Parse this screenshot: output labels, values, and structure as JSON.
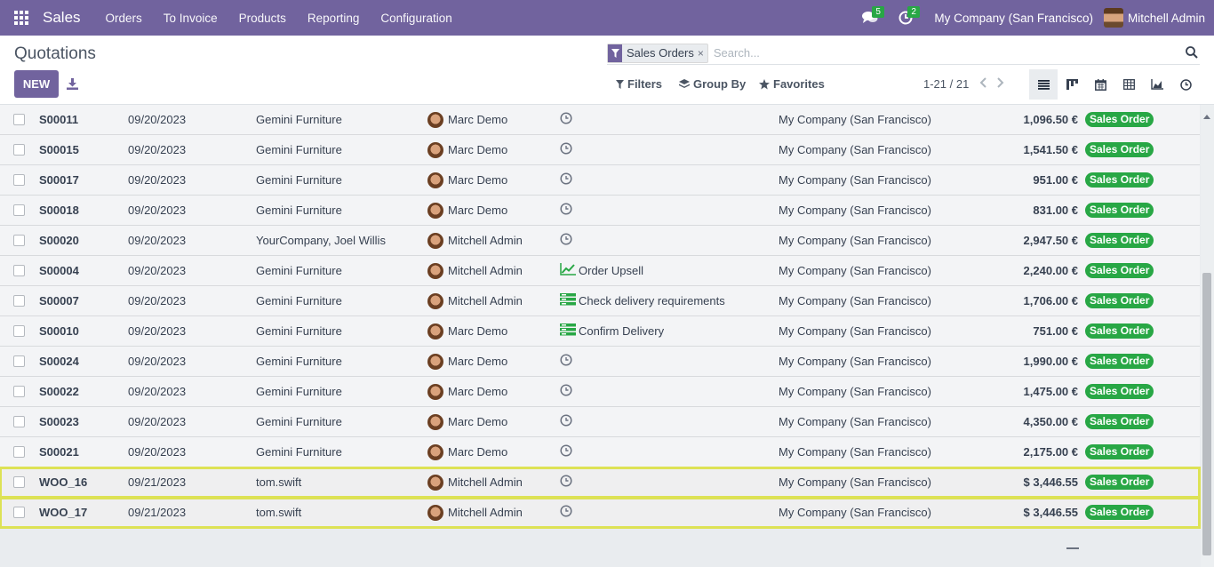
{
  "navbar": {
    "brand": "Sales",
    "menu": [
      "Orders",
      "To Invoice",
      "Products",
      "Reporting",
      "Configuration"
    ],
    "messages_count": "5",
    "activities_count": "2",
    "company": "My Company (San Francisco)",
    "user": "Mitchell Admin",
    "bg_color": "#71639e"
  },
  "control": {
    "title": "Quotations",
    "new_label": "NEW",
    "facet_label": "Sales Orders",
    "facet_remove": "×",
    "search_placeholder": "Search...",
    "filters_label": "Filters",
    "groupby_label": "Group By",
    "favorites_label": "Favorites",
    "pager": "1-21 / 21"
  },
  "rows": [
    {
      "number": "S00011",
      "date": "09/20/2023",
      "customer": "Gemini Furniture",
      "salesperson": "Marc Demo",
      "activity_icon": "clock-icon",
      "activity": "",
      "company": "My Company (San Francisco)",
      "total": "1,096.50 €",
      "status": "Sales Order"
    },
    {
      "number": "S00015",
      "date": "09/20/2023",
      "customer": "Gemini Furniture",
      "salesperson": "Marc Demo",
      "activity_icon": "clock-icon",
      "activity": "",
      "company": "My Company (San Francisco)",
      "total": "1,541.50 €",
      "status": "Sales Order"
    },
    {
      "number": "S00017",
      "date": "09/20/2023",
      "customer": "Gemini Furniture",
      "salesperson": "Marc Demo",
      "activity_icon": "clock-icon",
      "activity": "",
      "company": "My Company (San Francisco)",
      "total": "951.00 €",
      "status": "Sales Order"
    },
    {
      "number": "S00018",
      "date": "09/20/2023",
      "customer": "Gemini Furniture",
      "salesperson": "Marc Demo",
      "activity_icon": "clock-icon",
      "activity": "",
      "company": "My Company (San Francisco)",
      "total": "831.00 €",
      "status": "Sales Order"
    },
    {
      "number": "S00020",
      "date": "09/20/2023",
      "customer": "YourCompany, Joel Willis",
      "salesperson": "Mitchell Admin",
      "activity_icon": "clock-icon",
      "activity": "",
      "company": "My Company (San Francisco)",
      "total": "2,947.50 €",
      "status": "Sales Order"
    },
    {
      "number": "S00004",
      "date": "09/20/2023",
      "customer": "Gemini Furniture",
      "salesperson": "Mitchell Admin",
      "activity_icon": "line-chart-icon",
      "activity": "Order Upsell",
      "company": "My Company (San Francisco)",
      "total": "2,240.00 €",
      "status": "Sales Order"
    },
    {
      "number": "S00007",
      "date": "09/20/2023",
      "customer": "Gemini Furniture",
      "salesperson": "Mitchell Admin",
      "activity_icon": "tasks-icon",
      "activity": "Check delivery requirements",
      "company": "My Company (San Francisco)",
      "total": "1,706.00 €",
      "status": "Sales Order"
    },
    {
      "number": "S00010",
      "date": "09/20/2023",
      "customer": "Gemini Furniture",
      "salesperson": "Marc Demo",
      "activity_icon": "tasks-icon",
      "activity": "Confirm Delivery",
      "company": "My Company (San Francisco)",
      "total": "751.00 €",
      "status": "Sales Order"
    },
    {
      "number": "S00024",
      "date": "09/20/2023",
      "customer": "Gemini Furniture",
      "salesperson": "Marc Demo",
      "activity_icon": "clock-icon",
      "activity": "",
      "company": "My Company (San Francisco)",
      "total": "1,990.00 €",
      "status": "Sales Order"
    },
    {
      "number": "S00022",
      "date": "09/20/2023",
      "customer": "Gemini Furniture",
      "salesperson": "Marc Demo",
      "activity_icon": "clock-icon",
      "activity": "",
      "company": "My Company (San Francisco)",
      "total": "1,475.00 €",
      "status": "Sales Order"
    },
    {
      "number": "S00023",
      "date": "09/20/2023",
      "customer": "Gemini Furniture",
      "salesperson": "Marc Demo",
      "activity_icon": "clock-icon",
      "activity": "",
      "company": "My Company (San Francisco)",
      "total": "4,350.00 €",
      "status": "Sales Order"
    },
    {
      "number": "S00021",
      "date": "09/20/2023",
      "customer": "Gemini Furniture",
      "salesperson": "Marc Demo",
      "activity_icon": "clock-icon",
      "activity": "",
      "company": "My Company (San Francisco)",
      "total": "2,175.00 €",
      "status": "Sales Order"
    },
    {
      "number": "WOO_16",
      "date": "09/21/2023",
      "customer": "tom.swift",
      "salesperson": "Mitchell Admin",
      "activity_icon": "clock-icon",
      "activity": "",
      "company": "My Company (San Francisco)",
      "total": "$ 3,446.55",
      "status": "Sales Order",
      "highlighted": true
    },
    {
      "number": "WOO_17",
      "date": "09/21/2023",
      "customer": "tom.swift",
      "salesperson": "Mitchell Admin",
      "activity_icon": "clock-icon",
      "activity": "",
      "company": "My Company (San Francisco)",
      "total": "$ 3,446.55",
      "status": "Sales Order",
      "highlighted": true
    }
  ],
  "colors": {
    "status_green": "#28a745",
    "highlight_outline": "#dde255",
    "primary": "#71639e"
  }
}
